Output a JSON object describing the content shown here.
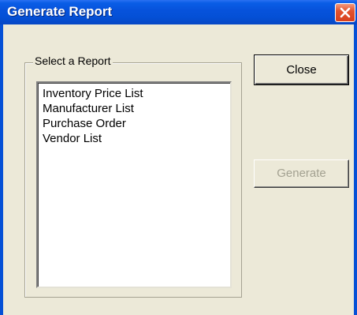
{
  "window": {
    "title": "Generate Report"
  },
  "report_group": {
    "label": "Select a Report",
    "items": [
      "Inventory Price List",
      "Manufacturer List",
      "Purchase Order",
      "Vendor List"
    ]
  },
  "buttons": {
    "close_label": "Close",
    "generate_label": "Generate",
    "generate_enabled": false
  },
  "colors": {
    "titlebar": "#0450d6",
    "dialog_background": "#ece9d8",
    "close_x": "#e2532e",
    "disabled_text": "#a3a191"
  },
  "icons": {
    "title_close": "close-icon"
  }
}
